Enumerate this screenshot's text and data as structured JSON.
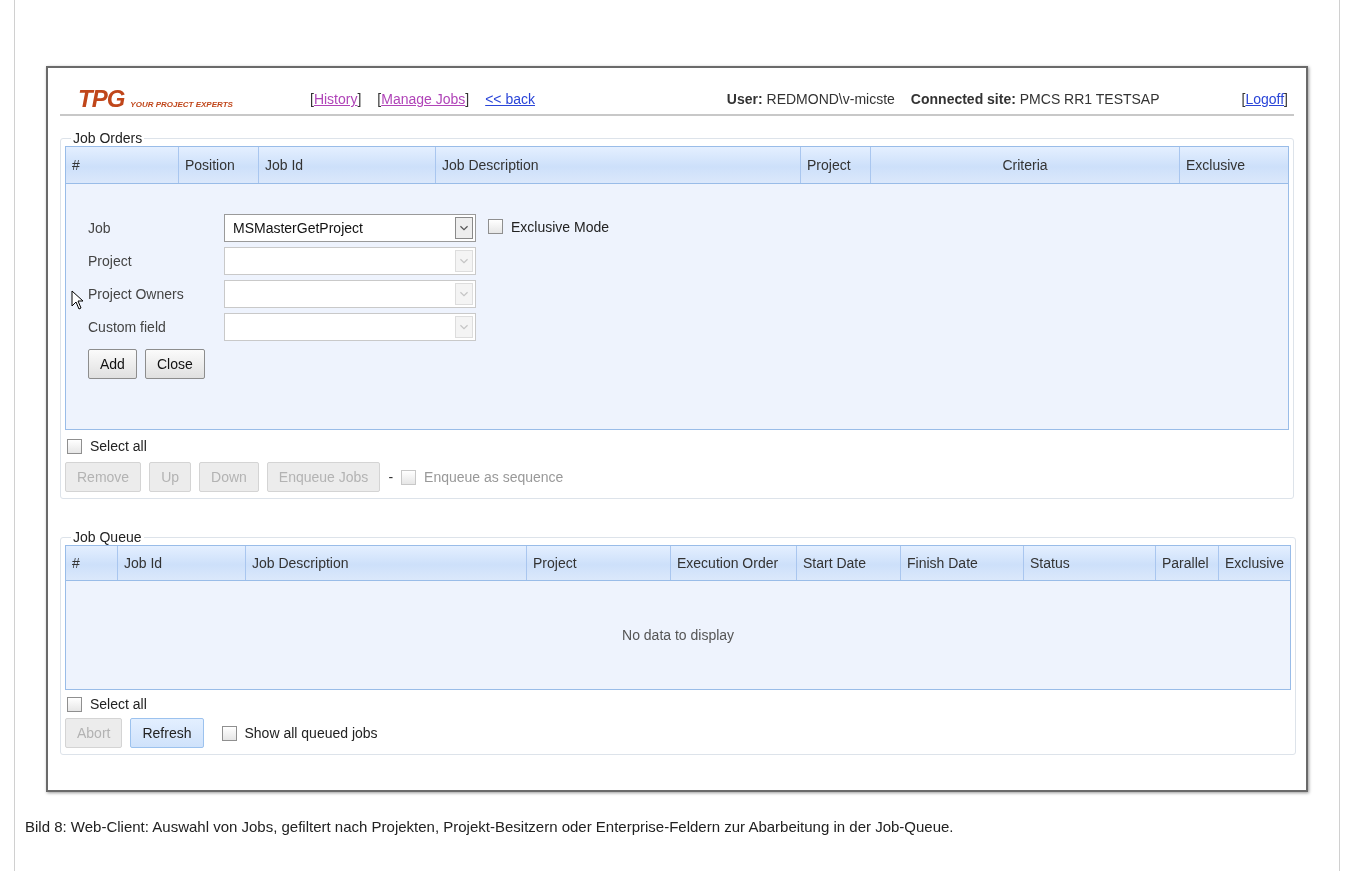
{
  "header": {
    "logo": {
      "mark": "TPG",
      "tagline": "YOUR PROJECT EXPERTS"
    },
    "nav_links": [
      {
        "prefix": "[",
        "label": "History",
        "suffix": "]",
        "visited": true
      },
      {
        "prefix": "[",
        "label": "Manage Jobs",
        "suffix": "]",
        "visited": true
      },
      {
        "label": "<< back",
        "visited": false
      }
    ],
    "user_label": "User:",
    "user": "REDMOND\\v-micste",
    "site_label": "Connected site:",
    "site": "PMCS RR1 TESTSAP",
    "logoff": {
      "prefix": "[",
      "label": "Logoff",
      "suffix": "]",
      "visited": false
    }
  },
  "job_orders": {
    "title": "Job Orders",
    "columns": [
      "#",
      "Position",
      "Job Id",
      "Job Description",
      "Project",
      "Criteria",
      "Exclusive"
    ],
    "form": {
      "fields": [
        {
          "label": "Job",
          "value": "MSMasterGetProject",
          "disabled": false
        },
        {
          "label": "Project",
          "disabled": true
        },
        {
          "label": "Project Owners",
          "disabled": true
        },
        {
          "label": "Custom field",
          "disabled": true
        }
      ],
      "exclusive_mode": {
        "label": "Exclusive Mode",
        "checked": false
      },
      "buttons": [
        {
          "label": "Add",
          "disabled": false
        },
        {
          "label": "Close",
          "disabled": false
        }
      ]
    },
    "select_all": {
      "label": "Select all",
      "checked": false
    },
    "actions": [
      {
        "label": "Remove",
        "disabled": true
      },
      {
        "label": "Up",
        "disabled": true
      },
      {
        "label": "Down",
        "disabled": true
      },
      {
        "label": "Enqueue Jobs",
        "disabled": true
      }
    ],
    "separator": "-",
    "enqueue_sequence": {
      "label": "Enqueue as sequence",
      "checked": false,
      "disabled": true
    }
  },
  "job_queue": {
    "title": "Job Queue",
    "columns": [
      "#",
      "Job Id",
      "Job Description",
      "Project",
      "Execution Order",
      "Start Date",
      "Finish Date",
      "Status",
      "Parallel",
      "Exclusive"
    ],
    "empty_text": "No data to display",
    "select_all": {
      "label": "Select all",
      "checked": false
    },
    "actions": [
      {
        "label": "Abort",
        "disabled": true,
        "highlighted": false
      },
      {
        "label": "Refresh",
        "disabled": false,
        "highlighted": true
      }
    ],
    "show_all": {
      "label": "Show all queued jobs",
      "checked": false
    }
  },
  "caption": "Bild 8: Web-Client: Auswahl von Jobs, gefiltert nach Projekten, Projekt-Besitzern oder Enterprise-Feldern zur Abarbeitung in der Job-Queue."
}
